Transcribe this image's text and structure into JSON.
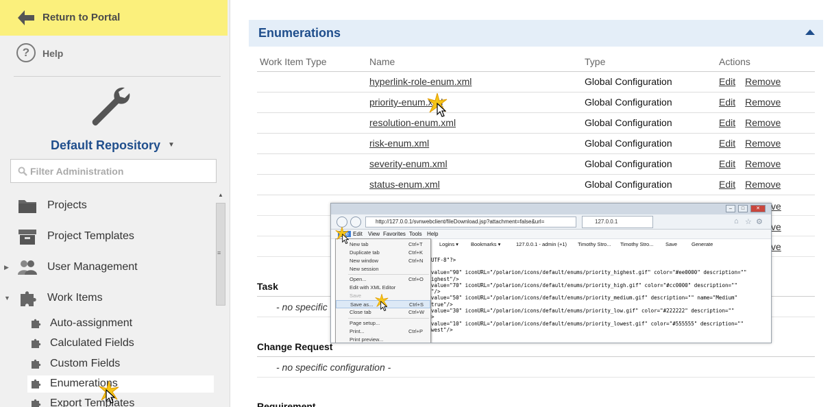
{
  "sidebar": {
    "return_label": "Return to Portal",
    "help_label": "Help",
    "help_glyph": "?",
    "repository": "Default Repository",
    "repository_caret": "▼",
    "filter_placeholder": "Filter Administration",
    "nav": [
      {
        "label": "Projects",
        "icon": "folder-icon"
      },
      {
        "label": "Project Templates",
        "icon": "archive-box-icon"
      },
      {
        "label": "User Management",
        "icon": "users-icon",
        "twisty": "▶"
      },
      {
        "label": "Work Items",
        "icon": "puzzle-icon",
        "twisty": "▼"
      }
    ],
    "sub_nav": [
      {
        "label": "Auto-assignment"
      },
      {
        "label": "Calculated Fields"
      },
      {
        "label": "Custom Fields"
      },
      {
        "label": "Enumerations",
        "active": true
      },
      {
        "label": "Export Templates"
      }
    ]
  },
  "main": {
    "section_title": "Enumerations",
    "columns": [
      "Work Item Type",
      "Name",
      "Type",
      "Actions"
    ],
    "rows": [
      {
        "type_col": "",
        "name": "hyperlink-role-enum.xml",
        "type": "Global Configuration"
      },
      {
        "type_col": "",
        "name": "priority-enum.xml",
        "type": "Global Configuration"
      },
      {
        "type_col": "",
        "name": "resolution-enum.xml",
        "type": "Global Configuration"
      },
      {
        "type_col": "",
        "name": "risk-enum.xml",
        "type": "Global Configuration"
      },
      {
        "type_col": "",
        "name": "severity-enum.xml",
        "type": "Global Configuration"
      },
      {
        "type_col": "",
        "name": "status-enum.xml",
        "type": "Global Configuration"
      }
    ],
    "action_edit": "Edit",
    "action_remove": "Remove",
    "partial_remove": "ve",
    "groups": [
      {
        "title": "Task",
        "note": "- no specific"
      },
      {
        "title": "Change Request",
        "note": "- no specific configuration -"
      },
      {
        "title": "Requirement"
      }
    ]
  },
  "overlay": {
    "url": "http://127.0.0.1/svnwebclient/fileDownload.jsp?attachment=false&url=",
    "tab_label": "127.0.0.1",
    "menubar": [
      "File",
      "Edit",
      "View",
      "Favorites",
      "Tools",
      "Help"
    ],
    "favorites": [
      "Logins ▾",
      "Bookmarks ▾",
      "127.0.0.1 - admin (+1)",
      "Timothy Stro...",
      "Timothy Stro...",
      "Save",
      "Generate"
    ],
    "file_menu": [
      {
        "label": "New tab",
        "shortcut": "Ctrl+T"
      },
      {
        "label": "Duplicate tab",
        "shortcut": "Ctrl+K"
      },
      {
        "label": "New window",
        "shortcut": "Ctrl+N"
      },
      {
        "label": "New session",
        "shortcut": ""
      },
      {
        "label": "Open...",
        "shortcut": "Ctrl+O"
      },
      {
        "label": "Edit with XML Editor",
        "shortcut": ""
      },
      {
        "label": "Save",
        "shortcut": "",
        "disabled": true
      },
      {
        "label": "Save as...",
        "shortcut": "Ctrl+S",
        "highlight": true
      },
      {
        "label": "Close tab",
        "shortcut": "Ctrl+W"
      },
      {
        "label": "Page setup...",
        "shortcut": ""
      },
      {
        "label": "Print...",
        "shortcut": "Ctrl+P"
      },
      {
        "label": "Print preview...",
        "shortcut": ""
      }
    ],
    "xml_lines": [
      "UTF-8\"?>",
      "value=\"90\" iconURL=\"/polarion/icons/default/enums/priority_highest.gif\" color=\"#ee0000\" description=\"\"",
      "ighest\"/>",
      "value=\"70\" iconURL=\"/polarion/icons/default/enums/priority_high.gif\" color=\"#cc0000\" description=\"\"",
      "\"/>",
      "value=\"50\" iconURL=\"/polarion/icons/default/enums/priority_medium.gif\" description=\"\" name=\"Medium\"",
      "true\"/>",
      "value=\"30\" iconURL=\"/polarion/icons/default/enums/priority_low.gif\" color=\"#222222\" description=\"\"",
      ">",
      "value=\"10\" iconURL=\"/polarion/icons/default/enums/priority_lowest.gif\" color=\"#555555\" description=\"\"",
      "west\"/>"
    ]
  },
  "colors": {
    "accent": "#1f4e8c",
    "return_bg": "#fbf07c",
    "section_bg": "#e4eef8"
  }
}
